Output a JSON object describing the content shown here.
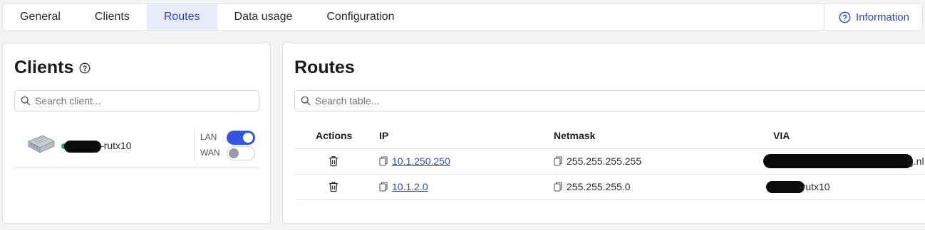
{
  "tabs": [
    {
      "label": "General"
    },
    {
      "label": "Clients"
    },
    {
      "label": "Routes"
    },
    {
      "label": "Data usage"
    },
    {
      "label": "Configuration"
    }
  ],
  "information_label": "Information",
  "clients": {
    "title": "Clients",
    "search_placeholder": "Search client...",
    "client": {
      "name_suffix": "-rutx10",
      "status_color": "#21a65a",
      "interfaces": [
        {
          "label": "LAN",
          "enabled": true
        },
        {
          "label": "WAN",
          "enabled": false
        }
      ]
    }
  },
  "routes": {
    "title": "Routes",
    "search_placeholder": "Search table...",
    "columns": [
      "Actions",
      "IP",
      "Netmask",
      "VIA"
    ],
    "rows": [
      {
        "ip": "10.1.250.250",
        "netmask": "255.255.255.255",
        "via_suffix": "g.nl"
      },
      {
        "ip": "10.1.2.0",
        "netmask": "255.255.255.0",
        "via_suffix": "-rutx10"
      }
    ]
  },
  "colors": {
    "accent": "#2c45c9",
    "toggle_on": "#3355e0",
    "active_tab_bg": "#e8ecfa"
  }
}
